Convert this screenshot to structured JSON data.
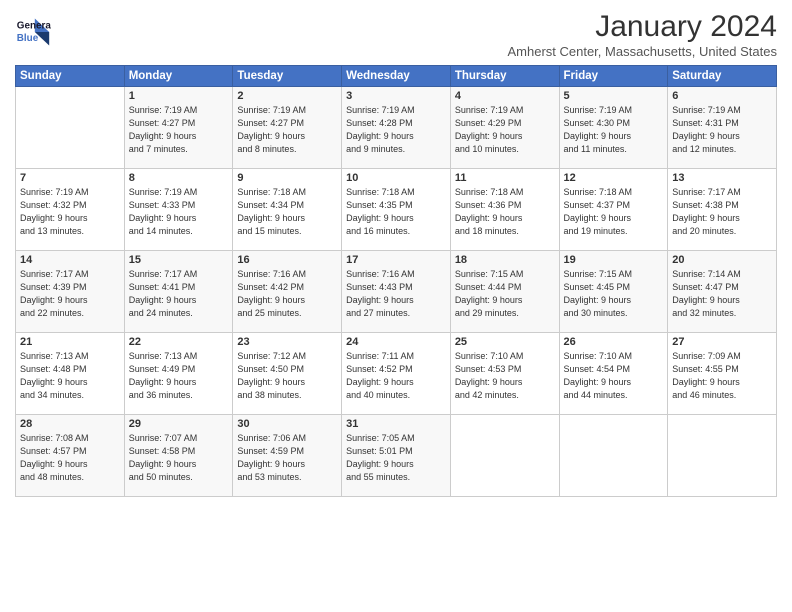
{
  "logo": {
    "line1": "General",
    "line2": "Blue"
  },
  "title": "January 2024",
  "location": "Amherst Center, Massachusetts, United States",
  "header_days": [
    "Sunday",
    "Monday",
    "Tuesday",
    "Wednesday",
    "Thursday",
    "Friday",
    "Saturday"
  ],
  "weeks": [
    [
      {
        "day": "",
        "info": ""
      },
      {
        "day": "1",
        "info": "Sunrise: 7:19 AM\nSunset: 4:27 PM\nDaylight: 9 hours\nand 7 minutes."
      },
      {
        "day": "2",
        "info": "Sunrise: 7:19 AM\nSunset: 4:27 PM\nDaylight: 9 hours\nand 8 minutes."
      },
      {
        "day": "3",
        "info": "Sunrise: 7:19 AM\nSunset: 4:28 PM\nDaylight: 9 hours\nand 9 minutes."
      },
      {
        "day": "4",
        "info": "Sunrise: 7:19 AM\nSunset: 4:29 PM\nDaylight: 9 hours\nand 10 minutes."
      },
      {
        "day": "5",
        "info": "Sunrise: 7:19 AM\nSunset: 4:30 PM\nDaylight: 9 hours\nand 11 minutes."
      },
      {
        "day": "6",
        "info": "Sunrise: 7:19 AM\nSunset: 4:31 PM\nDaylight: 9 hours\nand 12 minutes."
      }
    ],
    [
      {
        "day": "7",
        "info": "Sunrise: 7:19 AM\nSunset: 4:32 PM\nDaylight: 9 hours\nand 13 minutes."
      },
      {
        "day": "8",
        "info": "Sunrise: 7:19 AM\nSunset: 4:33 PM\nDaylight: 9 hours\nand 14 minutes."
      },
      {
        "day": "9",
        "info": "Sunrise: 7:18 AM\nSunset: 4:34 PM\nDaylight: 9 hours\nand 15 minutes."
      },
      {
        "day": "10",
        "info": "Sunrise: 7:18 AM\nSunset: 4:35 PM\nDaylight: 9 hours\nand 16 minutes."
      },
      {
        "day": "11",
        "info": "Sunrise: 7:18 AM\nSunset: 4:36 PM\nDaylight: 9 hours\nand 18 minutes."
      },
      {
        "day": "12",
        "info": "Sunrise: 7:18 AM\nSunset: 4:37 PM\nDaylight: 9 hours\nand 19 minutes."
      },
      {
        "day": "13",
        "info": "Sunrise: 7:17 AM\nSunset: 4:38 PM\nDaylight: 9 hours\nand 20 minutes."
      }
    ],
    [
      {
        "day": "14",
        "info": "Sunrise: 7:17 AM\nSunset: 4:39 PM\nDaylight: 9 hours\nand 22 minutes."
      },
      {
        "day": "15",
        "info": "Sunrise: 7:17 AM\nSunset: 4:41 PM\nDaylight: 9 hours\nand 24 minutes."
      },
      {
        "day": "16",
        "info": "Sunrise: 7:16 AM\nSunset: 4:42 PM\nDaylight: 9 hours\nand 25 minutes."
      },
      {
        "day": "17",
        "info": "Sunrise: 7:16 AM\nSunset: 4:43 PM\nDaylight: 9 hours\nand 27 minutes."
      },
      {
        "day": "18",
        "info": "Sunrise: 7:15 AM\nSunset: 4:44 PM\nDaylight: 9 hours\nand 29 minutes."
      },
      {
        "day": "19",
        "info": "Sunrise: 7:15 AM\nSunset: 4:45 PM\nDaylight: 9 hours\nand 30 minutes."
      },
      {
        "day": "20",
        "info": "Sunrise: 7:14 AM\nSunset: 4:47 PM\nDaylight: 9 hours\nand 32 minutes."
      }
    ],
    [
      {
        "day": "21",
        "info": "Sunrise: 7:13 AM\nSunset: 4:48 PM\nDaylight: 9 hours\nand 34 minutes."
      },
      {
        "day": "22",
        "info": "Sunrise: 7:13 AM\nSunset: 4:49 PM\nDaylight: 9 hours\nand 36 minutes."
      },
      {
        "day": "23",
        "info": "Sunrise: 7:12 AM\nSunset: 4:50 PM\nDaylight: 9 hours\nand 38 minutes."
      },
      {
        "day": "24",
        "info": "Sunrise: 7:11 AM\nSunset: 4:52 PM\nDaylight: 9 hours\nand 40 minutes."
      },
      {
        "day": "25",
        "info": "Sunrise: 7:10 AM\nSunset: 4:53 PM\nDaylight: 9 hours\nand 42 minutes."
      },
      {
        "day": "26",
        "info": "Sunrise: 7:10 AM\nSunset: 4:54 PM\nDaylight: 9 hours\nand 44 minutes."
      },
      {
        "day": "27",
        "info": "Sunrise: 7:09 AM\nSunset: 4:55 PM\nDaylight: 9 hours\nand 46 minutes."
      }
    ],
    [
      {
        "day": "28",
        "info": "Sunrise: 7:08 AM\nSunset: 4:57 PM\nDaylight: 9 hours\nand 48 minutes."
      },
      {
        "day": "29",
        "info": "Sunrise: 7:07 AM\nSunset: 4:58 PM\nDaylight: 9 hours\nand 50 minutes."
      },
      {
        "day": "30",
        "info": "Sunrise: 7:06 AM\nSunset: 4:59 PM\nDaylight: 9 hours\nand 53 minutes."
      },
      {
        "day": "31",
        "info": "Sunrise: 7:05 AM\nSunset: 5:01 PM\nDaylight: 9 hours\nand 55 minutes."
      },
      {
        "day": "",
        "info": ""
      },
      {
        "day": "",
        "info": ""
      },
      {
        "day": "",
        "info": ""
      }
    ]
  ]
}
